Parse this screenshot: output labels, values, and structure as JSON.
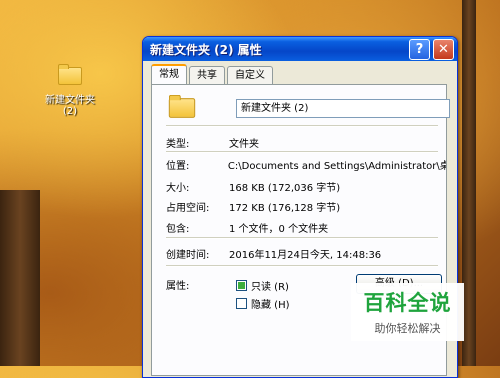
{
  "desktop": {
    "icon_label_line1": "新建文件夹",
    "icon_label_line2": "(2)"
  },
  "window": {
    "title": "新建文件夹 (2) 属性",
    "help_glyph": "?",
    "close_glyph": "✕",
    "tabs": [
      {
        "label": "常规",
        "active": true
      },
      {
        "label": "共享",
        "active": false
      },
      {
        "label": "自定义",
        "active": false
      }
    ],
    "name_value": "新建文件夹 (2)",
    "properties": [
      {
        "label": "类型:",
        "value": "文件夹"
      },
      {
        "label": "位置:",
        "value": "C:\\Documents and Settings\\Administrator\\桌"
      },
      {
        "label": "大小:",
        "value": "168 KB (172,036 字节)"
      },
      {
        "label": "占用空间:",
        "value": "172 KB (176,128 字节)"
      },
      {
        "label": "包含:",
        "value": "1 个文件，0 个文件夹"
      },
      {
        "label": "创建时间:",
        "value": "2016年11月24日今天, 14:48:36"
      }
    ],
    "attributes_label": "属性:",
    "readonly_label": "只读 (R)",
    "readonly_checked": true,
    "hidden_label": "隐藏 (H)",
    "hidden_checked": false,
    "advanced_button": "高级 (D)..."
  },
  "watermark": {
    "main": "百科全说",
    "sub": "助你轻松解决"
  }
}
